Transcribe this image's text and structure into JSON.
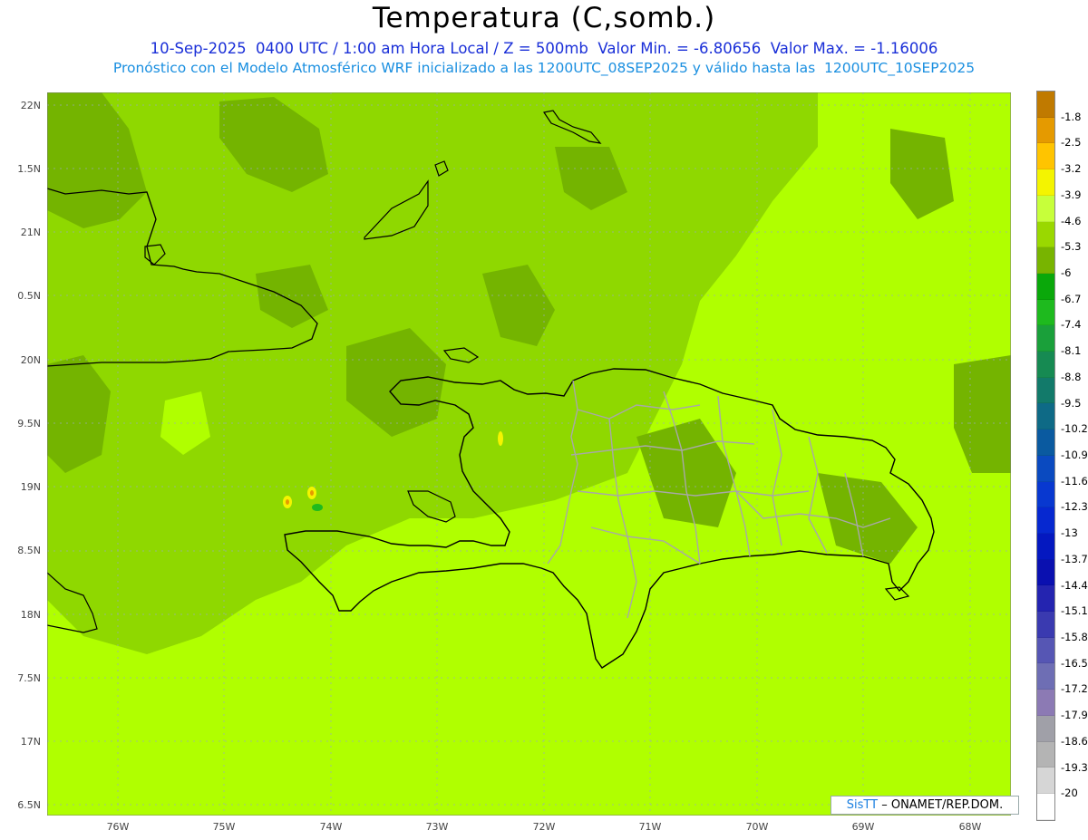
{
  "header": {
    "title": "Temperatura (C,somb.)",
    "line1": "10-Sep-2025  0400 UTC / 1:00 am Hora Local / Z = 500mb  Valor Min. = -6.80656  Valor Max. = -1.16006",
    "line2": "Pronóstico con el Modelo Atmosférico WRF inicializado a las 1200UTC_08SEP2025 y válido hasta las  1200UTC_10SEP2025"
  },
  "axes": {
    "lat_labels": [
      "22N",
      "1.5N",
      "21N",
      "0.5N",
      "20N",
      "9.5N",
      "19N",
      "8.5N",
      "18N",
      "7.5N",
      "17N",
      "6.5N"
    ],
    "lon_labels": [
      "76W",
      "75W",
      "74W",
      "73W",
      "72W",
      "71W",
      "70W",
      "69W",
      "68W"
    ]
  },
  "colorbar": {
    "labels": [
      "-1.8",
      "-2.5",
      "-3.2",
      "-3.9",
      "-4.6",
      "-5.3",
      "-6",
      "-6.7",
      "-7.4",
      "-8.1",
      "-8.8",
      "-9.5",
      "-10.2",
      "-10.9",
      "-11.6",
      "-12.3",
      "-13",
      "-13.7",
      "-14.4",
      "-15.1",
      "-15.8",
      "-16.5",
      "-17.2",
      "-17.9",
      "-18.6",
      "-19.3",
      "-20"
    ],
    "colors": [
      "#c07a00",
      "#e59a00",
      "#ffc400",
      "#f4f400",
      "#c7ff3a",
      "#9ad800",
      "#78b400",
      "#0aa80a",
      "#1eba1e",
      "#1aa03a",
      "#168a52",
      "#127a6a",
      "#0e6a86",
      "#0a5aa0",
      "#0a4ac0",
      "#0838d0",
      "#0628d0",
      "#0418c0",
      "#0a10b0",
      "#2424b0",
      "#3a3ab0",
      "#5656b4",
      "#6e6eb4",
      "#8c7ab4",
      "#a0a0a8",
      "#b4b4b4",
      "#d6d6d6",
      "#ffffff"
    ]
  },
  "credit": {
    "brand": "SisTT",
    "text": "– ONAMET/REP.DOM."
  },
  "field": {
    "base_color": "#8fd800",
    "light_color": "#b0ff00",
    "dark_color": "#74b400"
  }
}
